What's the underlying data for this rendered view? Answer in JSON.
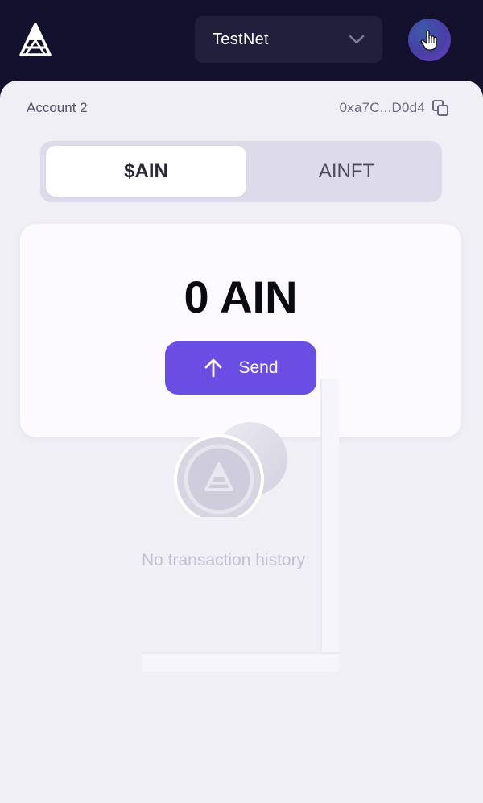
{
  "header": {
    "network": "TestNet",
    "logo_icon": "ain-logo-icon",
    "avatar_icon": "hand-pointer-icon"
  },
  "account": {
    "name": "Account 2",
    "address": "0xa7C...D0d4",
    "copy_icon": "copy-icon"
  },
  "tabs": [
    {
      "label": "$AIN",
      "active": true
    },
    {
      "label": "AINFT",
      "active": false
    }
  ],
  "balance": {
    "amount": "0 AIN"
  },
  "actions": {
    "send_label": "Send",
    "send_icon": "arrow-up-icon"
  },
  "history": {
    "empty_message": "No transaction history"
  },
  "colors": {
    "header_bg": "#14112e",
    "accent": "#6a4ee3",
    "panel_bg": "#f0eff5"
  }
}
